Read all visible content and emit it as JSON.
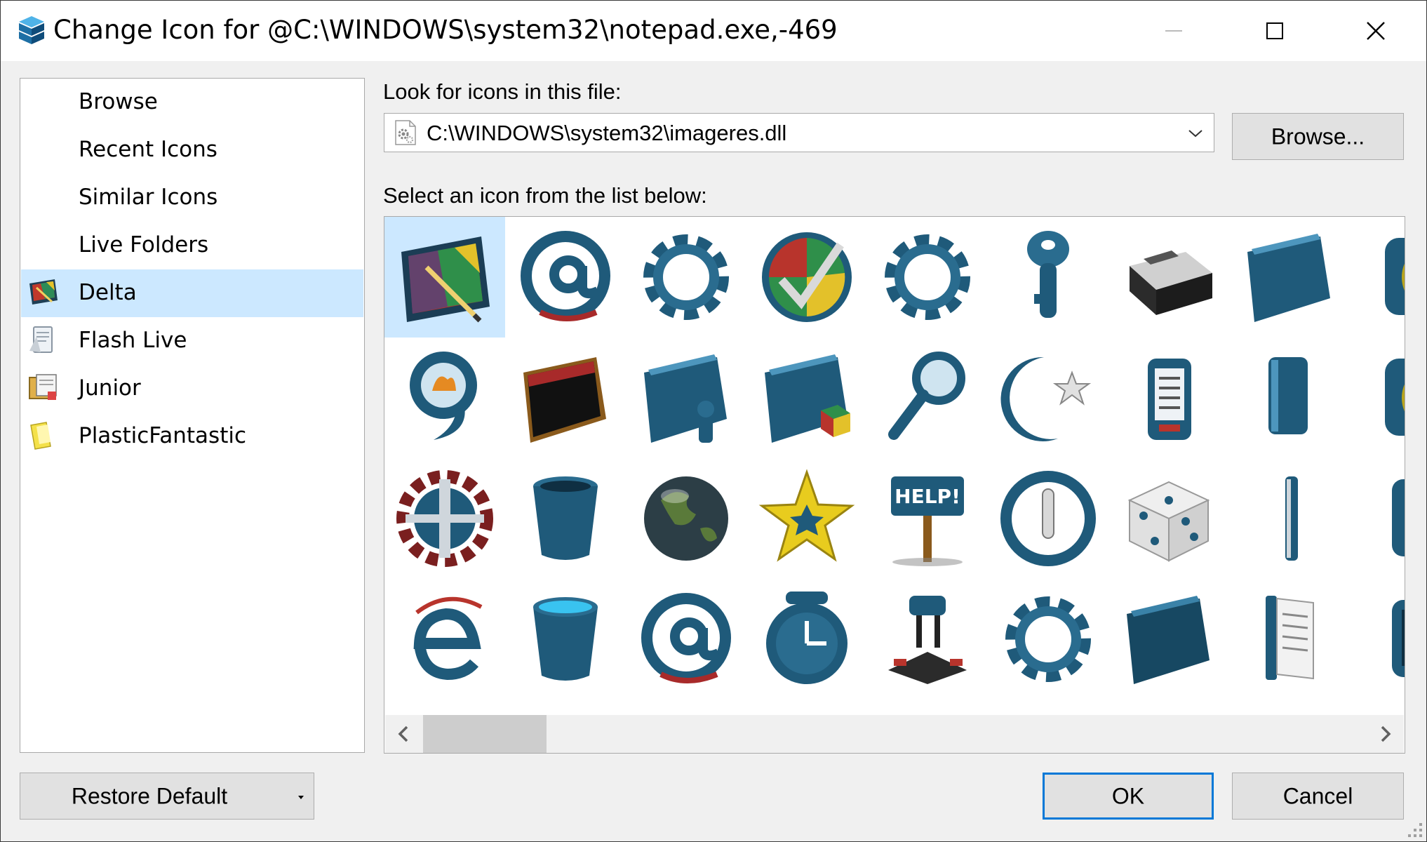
{
  "window": {
    "title": "Change Icon for @C:\\WINDOWS\\system32\\notepad.exe,-469",
    "app_icon": "cube-stack-icon",
    "controls": [
      "minimize-icon",
      "maximize-icon",
      "close-icon"
    ]
  },
  "sidebar": {
    "items": [
      {
        "label": "Browse",
        "icon": null,
        "selected": false
      },
      {
        "label": "Recent Icons",
        "icon": null,
        "selected": false
      },
      {
        "label": "Similar Icons",
        "icon": null,
        "selected": false
      },
      {
        "label": "Live Folders",
        "icon": null,
        "selected": false
      },
      {
        "label": "Delta",
        "icon": "delta-folder-icon",
        "selected": true
      },
      {
        "label": "Flash Live",
        "icon": "flash-live-icon",
        "selected": false
      },
      {
        "label": "Junior",
        "icon": "junior-folder-icon",
        "selected": false
      },
      {
        "label": "PlasticFantastic",
        "icon": "plastic-folder-icon",
        "selected": false
      }
    ]
  },
  "file": {
    "label": "Look for icons in this file:",
    "path": "C:\\WINDOWS\\system32\\imageres.dll",
    "icon": "dll-gear-icon",
    "browse_label": "Browse..."
  },
  "icons": {
    "label": "Select an icon from the list below:",
    "rows": [
      [
        "paint-folder",
        "at-sign",
        "gear",
        "checkmark-disc",
        "gear",
        "key",
        "printer",
        "blue-folder",
        "yellow-light"
      ],
      [
        "flame-swirl",
        "red-black-folder",
        "user-folder",
        "cube-folder",
        "magnifier",
        "crescent-star",
        "remote-control",
        "book",
        "yellow-light"
      ],
      [
        "globe-gear",
        "trash-bin",
        "earth",
        "gold-star",
        "help-sign",
        "power",
        "dice",
        "thin-book",
        "brown-box"
      ],
      [
        "e-logo",
        "water-bin",
        "at-sign",
        "clock",
        "chair",
        "gear",
        "dark-folder",
        "document-book",
        "monitor"
      ]
    ],
    "selected_index": 0
  },
  "buttons": {
    "restore": "Restore Default",
    "ok": "OK",
    "cancel": "Cancel"
  },
  "colors": {
    "selection": "#cce8ff",
    "accent": "#0078d7",
    "icon_blue": "#1f5a7a"
  }
}
